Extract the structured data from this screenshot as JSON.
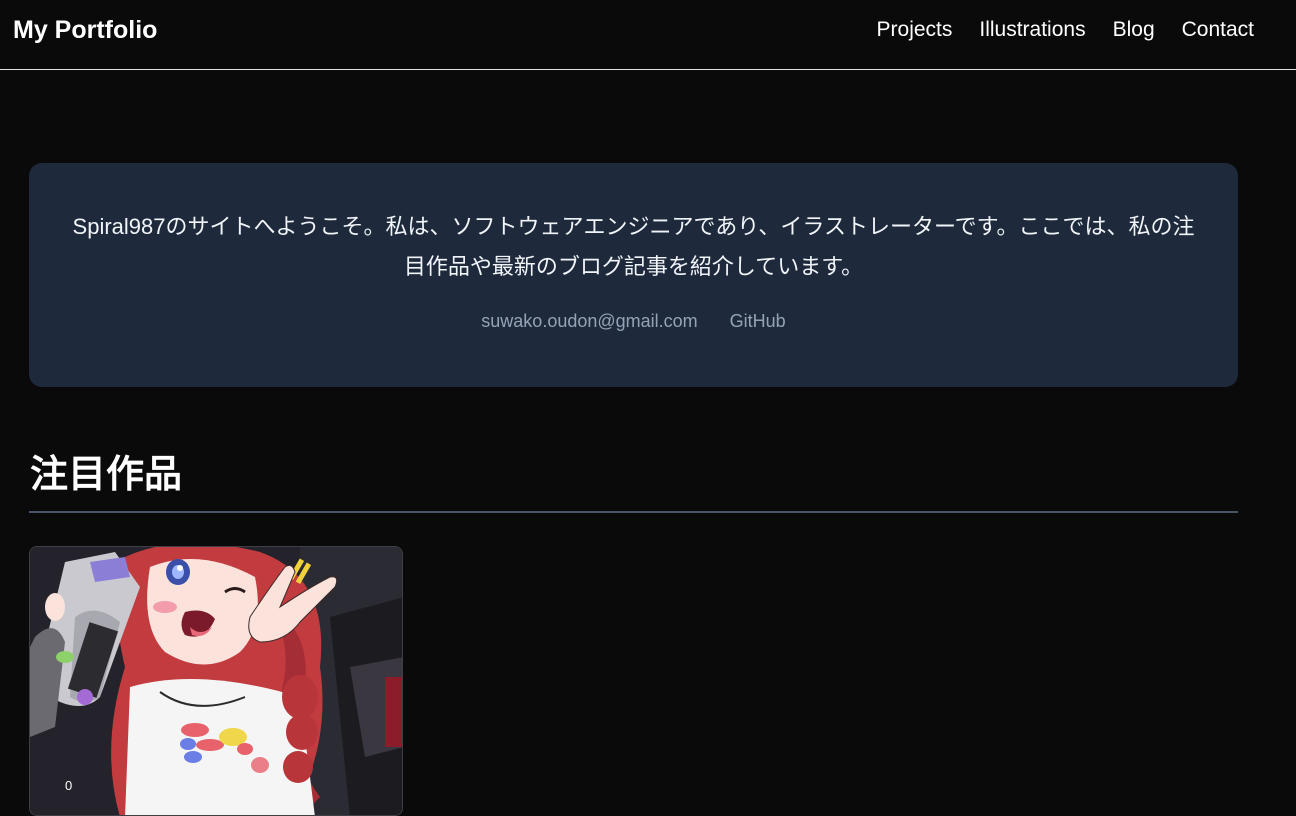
{
  "header": {
    "brand": "My Portfolio",
    "nav": [
      "Projects",
      "Illustrations",
      "Blog",
      "Contact"
    ]
  },
  "hero": {
    "intro": "Spiral987のサイトへようこそ。私は、ソフトウェアエンジニアであり、イラストレーターです。ここでは、私の注目作品や最新のブログ記事を紹介しています。",
    "email": "suwako.oudon@gmail.com",
    "github": "GitHub"
  },
  "featured": {
    "title": "注目作品",
    "cards": [
      {
        "image_icon": "illustration-image",
        "count": "0"
      }
    ]
  },
  "colors": {
    "background": "#0a0a0a",
    "hero_panel": "#1e293b",
    "muted_link": "#94a3b8",
    "rule": "#475569"
  }
}
